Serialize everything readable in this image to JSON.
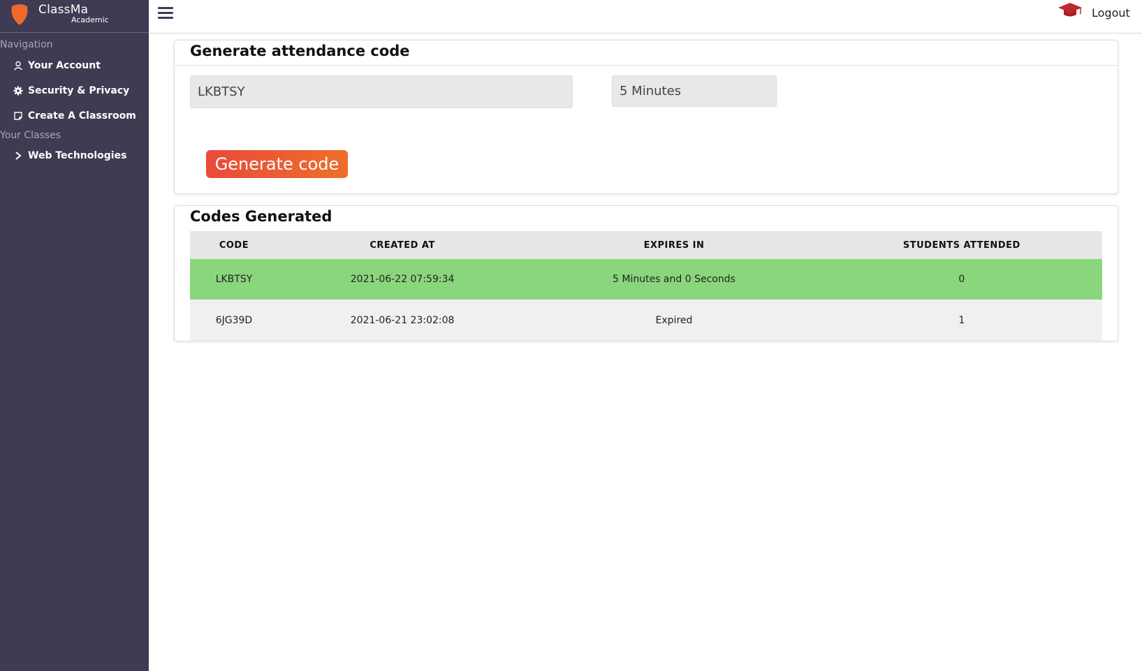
{
  "brand": {
    "name": "ClassMa",
    "subtitle": "Academic",
    "logo_icon": "shield-logo-icon",
    "accent": "#ee6a2c"
  },
  "sidebar": {
    "nav_label": "Navigation",
    "nav_items": [
      {
        "label": "Your Account",
        "icon": "user-icon"
      },
      {
        "label": "Security & Privacy",
        "icon": "gear-icon"
      },
      {
        "label": "Create A Classroom",
        "icon": "note-icon"
      }
    ],
    "classes_label": "Your Classes",
    "class_items": [
      {
        "label": "Web Technologies",
        "icon": "chevron-right-icon"
      }
    ],
    "bg_color": "#3e3b52"
  },
  "topbar": {
    "menu_icon": "hamburger-icon",
    "cap_icon": "graduation-cap-icon",
    "logout_label": "Logout"
  },
  "generate": {
    "title": "Generate attendance code",
    "code_value": "LKBTSY",
    "duration_value": "5 Minutes",
    "button_label": "Generate code"
  },
  "codes": {
    "title": "Codes Generated",
    "headers": [
      "CODE",
      "CREATED AT",
      "EXPIRES IN",
      "STUDENTS ATTENDED"
    ],
    "rows": [
      {
        "code": "LKBTSY",
        "created_at": "2021-06-22 07:59:34",
        "expires_in": "5 Minutes and 0 Seconds",
        "students": "0",
        "status": "active"
      },
      {
        "code": "6JG39D",
        "created_at": "2021-06-21 23:02:08",
        "expires_in": "Expired",
        "students": "1",
        "status": "expired"
      }
    ],
    "active_color": "#8ad67c"
  }
}
